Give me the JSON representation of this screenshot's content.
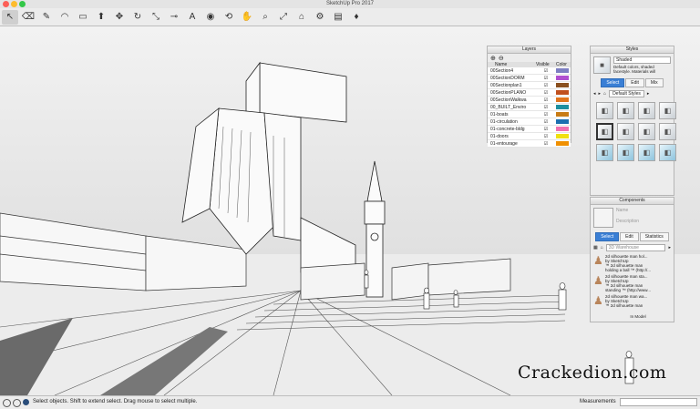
{
  "window": {
    "title": "SketchUp Pro 2017"
  },
  "toolbar": {
    "tools": [
      {
        "name": "select-tool",
        "icon": "arrow-cursor-icon",
        "glyph": "↖",
        "active": true
      },
      {
        "name": "eraser-tool",
        "icon": "eraser-icon",
        "glyph": "⌫"
      },
      {
        "name": "line-tool",
        "icon": "pencil-icon",
        "glyph": "✎"
      },
      {
        "name": "arc-tool",
        "icon": "arc-icon",
        "glyph": "◠"
      },
      {
        "name": "shape-tool",
        "icon": "rectangle-icon",
        "glyph": "▭"
      },
      {
        "name": "push-pull-tool",
        "icon": "push-pull-icon",
        "glyph": "⬆"
      },
      {
        "name": "move-tool",
        "icon": "move-icon",
        "glyph": "✥"
      },
      {
        "name": "rotate-tool",
        "icon": "rotate-icon",
        "glyph": "↻"
      },
      {
        "name": "scale-tool",
        "icon": "scale-icon",
        "glyph": "⤡"
      },
      {
        "name": "tape-measure-tool",
        "icon": "tape-measure-icon",
        "glyph": "⊸"
      },
      {
        "name": "text-tool",
        "icon": "text-icon",
        "glyph": "A"
      },
      {
        "name": "paint-bucket-tool",
        "icon": "paint-bucket-icon",
        "glyph": "◉"
      },
      {
        "name": "orbit-tool",
        "icon": "orbit-icon",
        "glyph": "⟲"
      },
      {
        "name": "pan-tool",
        "icon": "hand-icon",
        "glyph": "✋"
      },
      {
        "name": "zoom-tool",
        "icon": "magnifier-icon",
        "glyph": "⌕"
      },
      {
        "name": "zoom-extents-tool",
        "icon": "zoom-extents-icon",
        "glyph": "⤢"
      },
      {
        "name": "warehouse-tool",
        "icon": "warehouse-icon",
        "glyph": "⌂"
      },
      {
        "name": "extension-warehouse-tool",
        "icon": "extension-icon",
        "glyph": "⚙"
      },
      {
        "name": "send-to-layout-tool",
        "icon": "layout-icon",
        "glyph": "▤"
      },
      {
        "name": "extension-manager-tool",
        "icon": "ruby-icon",
        "glyph": "♦"
      }
    ]
  },
  "layers": {
    "title": "Layers",
    "col_name": "Name",
    "col_visible": "Visible",
    "col_color": "Color",
    "rows": [
      {
        "name": "00Section4",
        "color": "#7d7fc2"
      },
      {
        "name": "00SectionDORM",
        "color": "#b04fd0"
      },
      {
        "name": "00Sectionplan1",
        "color": "#8a4f1e"
      },
      {
        "name": "00SectionPLANO",
        "color": "#c0501e"
      },
      {
        "name": "00SectionWalkwa",
        "color": "#e0741c"
      },
      {
        "name": "00_BUILT_Enviro",
        "color": "#1c8fa0"
      },
      {
        "name": "01-boats",
        "color": "#c87b14"
      },
      {
        "name": "01-circulation",
        "color": "#1c6fb0"
      },
      {
        "name": "01-concrete-bldg",
        "color": "#f070b0"
      },
      {
        "name": "01-doors",
        "color": "#f0e010"
      },
      {
        "name": "01-entourage",
        "color": "#f09000"
      }
    ]
  },
  "styles": {
    "title": "Styles",
    "style_name": "Shaded",
    "style_desc": "Default colors, shaded facestyle. Materials will",
    "tabs": [
      "Select",
      "Edit",
      "Mix"
    ],
    "selected_tab": 0,
    "collection": "Default Styles"
  },
  "components": {
    "title": "Components",
    "name_label": "Name",
    "desc_label": "Description",
    "tabs": [
      "Select",
      "Edit",
      "Statistics"
    ],
    "selected_tab": 0,
    "search_placeholder": "3D Warehouse",
    "items": [
      {
        "lines": [
          "2d silhouette man hol...",
          "by SketchUp",
          "™ 2d silhouette man",
          "holding a ball ™ (http://..."
        ]
      },
      {
        "lines": [
          "2d silhouette man sta...",
          "by SketchUp",
          "™ 2d silhouette man",
          "standing ™ (http://www..."
        ]
      },
      {
        "lines": [
          "2d silhouette man wa...",
          "by SketchUp",
          "™ 2d silhouette man"
        ]
      },
      {
        "lines": [
          "In Model"
        ]
      }
    ]
  },
  "statusbar": {
    "hint": "Select objects. Shift to extend select. Drag mouse to select multiple.",
    "measurements_label": "Measurements",
    "measurements_value": ""
  },
  "watermark": {
    "text": "Crackedion.com"
  },
  "colors": {
    "accent": "#3a7fd5",
    "traffic_red": "#fc5f57",
    "traffic_yellow": "#fdbc2e",
    "traffic_green": "#33c748"
  }
}
